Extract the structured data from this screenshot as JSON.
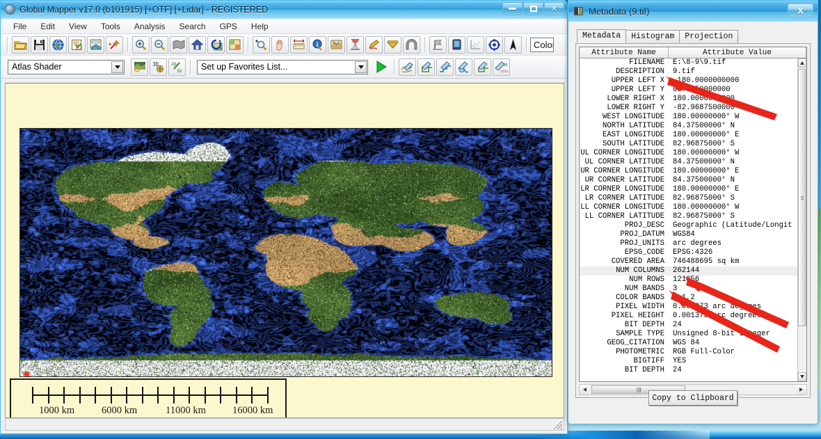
{
  "main_window": {
    "title": "Global Mapper v17.0 (b101915) [+OTF] [+Lidar] - REGISTERED",
    "icon": "globe-icon",
    "controls": {
      "minimize": "minimize-icon",
      "maximize": "maximize-icon",
      "close": "close-icon"
    },
    "menu": [
      "File",
      "Edit",
      "View",
      "Tools",
      "Analysis",
      "Search",
      "GPS",
      "Help"
    ],
    "toolbar_main": [
      "open-folder-icon",
      "save-disk-icon",
      "globe-web-icon",
      "layer-document-icon",
      "export-map-icon",
      "tools-wand-icon",
      "zoom-in-icon",
      "zoom-out-icon",
      "pan-shape-icon",
      "home-view-icon",
      "refresh-view-icon",
      "window-tile-icon",
      "zoom-select-icon",
      "hand-pan-icon",
      "measure-ruler-icon",
      "feature-info-icon",
      "path-profile-icon",
      "viewshed-icon",
      "digitizer-pencil-icon",
      "shader-dropdown-icon",
      "tunnel-arch-icon",
      "flag-marker-icon",
      "3d-view-icon",
      "point-cloud-icon",
      "crosshair-center-icon",
      "north-arrow-icon"
    ],
    "toolbar_secondary": {
      "shader_select_value": "Atlas Shader",
      "shader_icons": [
        "shader-preview-icon",
        "3d-overlay-icon",
        "2d-3d-convert-icon"
      ],
      "favorites_select_value": "Set up Favorites List...",
      "favorites_run": "play-run-icon",
      "digitizer_icons": [
        "create-area-icon",
        "create-rect-icon",
        "create-line-icon",
        "create-polygon-icon",
        "create-box-icon",
        "coordinate-entry-icon"
      ],
      "color_label": "Color"
    },
    "map": {
      "alt": "world-satellite-bathymetry-map",
      "scalebar": {
        "labels": [
          "1000 km",
          "6000 km",
          "11000 km",
          "16000 km"
        ],
        "tick_count": 16
      }
    }
  },
  "metadata_window": {
    "title": "Metadata (9.tif)",
    "icon": "metadata-window-icon",
    "close_label": "X",
    "tabs": [
      {
        "label": "Metadata",
        "active": true
      },
      {
        "label": "Histogram",
        "active": false
      },
      {
        "label": "Projection",
        "active": false
      }
    ],
    "grid": {
      "columns": [
        "Attribute Name",
        "Attribute Value"
      ],
      "rows": [
        {
          "name": "FILENAME",
          "value": "E:\\8-9\\9.tif"
        },
        {
          "name": "DESCRIPTION",
          "value": "9.tif"
        },
        {
          "name": "UPPER LEFT X",
          "value": "-180.0000000000"
        },
        {
          "name": "UPPER LEFT Y",
          "value": "84.3750000000"
        },
        {
          "name": "LOWER RIGHT X",
          "value": "180.0000000000"
        },
        {
          "name": "LOWER RIGHT Y",
          "value": "-82.9687500000"
        },
        {
          "name": "WEST LONGITUDE",
          "value": "180.00000000°  W"
        },
        {
          "name": "NORTH LATITUDE",
          "value": "84.37500000°  N"
        },
        {
          "name": "EAST LONGITUDE",
          "value": "180.00000000°  E"
        },
        {
          "name": "SOUTH LATITUDE",
          "value": "82.96875000°  S"
        },
        {
          "name": "UL CORNER LONGITUDE",
          "value": "180.00000000°  W"
        },
        {
          "name": "UL CORNER LATITUDE",
          "value": "84.37500000°  N"
        },
        {
          "name": "UR CORNER LONGITUDE",
          "value": "180.00000000°  E"
        },
        {
          "name": "UR CORNER LATITUDE",
          "value": "84.37500000°  N"
        },
        {
          "name": "LR CORNER LONGITUDE",
          "value": "180.00000000°  E"
        },
        {
          "name": "LR CORNER LATITUDE",
          "value": "82.96875000°  S"
        },
        {
          "name": "LL CORNER LONGITUDE",
          "value": "180.00000000°  W"
        },
        {
          "name": "LL CORNER LATITUDE",
          "value": "82.96875000°  S"
        },
        {
          "name": "PROJ_DESC",
          "value": "Geographic (Latitude/Longit"
        },
        {
          "name": "PROJ_DATUM",
          "value": "WGS84"
        },
        {
          "name": "PROJ_UNITS",
          "value": "arc degrees"
        },
        {
          "name": "EPSG_CODE",
          "value": "EPSG:4326"
        },
        {
          "name": "COVERED AREA",
          "value": "746488695 sq km"
        },
        {
          "name": "NUM COLUMNS",
          "value": "262144",
          "highlight": true
        },
        {
          "name": "NUM ROWS",
          "value": "121856"
        },
        {
          "name": "NUM BANDS",
          "value": "3"
        },
        {
          "name": "COLOR BANDS",
          "value": "0,1,2"
        },
        {
          "name": "PIXEL WIDTH",
          "value": "0.001373 arc degrees"
        },
        {
          "name": "PIXEL HEIGHT",
          "value": "0.001373 arc degrees"
        },
        {
          "name": "BIT DEPTH",
          "value": "24"
        },
        {
          "name": "SAMPLE TYPE",
          "value": "Unsigned 8-bit Integer"
        },
        {
          "name": "GEOG_CITATION",
          "value": "WGS 84"
        },
        {
          "name": "PHOTOMETRIC",
          "value": "RGB Full-Color"
        },
        {
          "name": "BIGTIFF",
          "value": "YES"
        },
        {
          "name": "BIT DEPTH",
          "value": "24"
        }
      ]
    },
    "copy_button": "Copy to Clipboard",
    "scroll": {
      "vertical_up": "scroll-up-arrow",
      "vertical_down": "scroll-down-arrow",
      "horizontal_left": "scroll-left-arrow",
      "horizontal_right": "scroll-right-arrow"
    }
  },
  "annotations": {
    "color": "#e8251b",
    "arrows": [
      {
        "name": "arrow-pointing-filename",
        "target": "DESCRIPTION / 9.tif"
      },
      {
        "name": "arrow-pointing-num-columns",
        "target": "NUM COLUMNS"
      },
      {
        "name": "arrow-pointing-num-rows",
        "target": "NUM ROWS"
      }
    ]
  }
}
